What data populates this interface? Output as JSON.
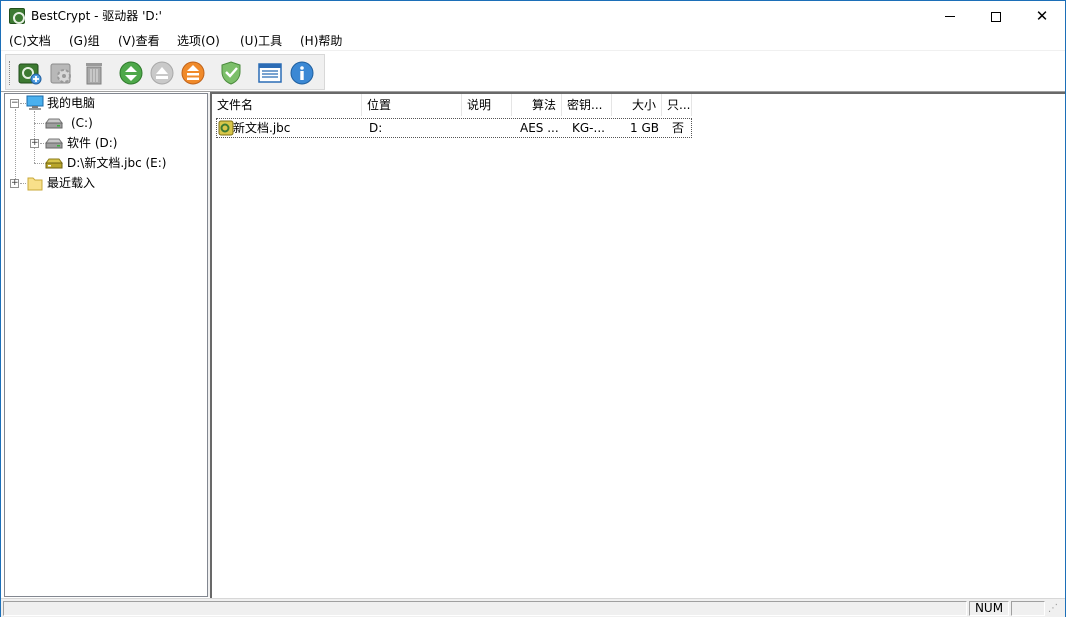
{
  "window": {
    "title": "BestCrypt - 驱动器 'D:'"
  },
  "menu": {
    "items": [
      "(C)文档",
      "(G)组",
      "(V)查看",
      "选项(O)",
      "(U)工具",
      "(H)帮助"
    ]
  },
  "toolbar": {
    "buttons": [
      {
        "name": "new-container-icon",
        "color": "#3d7a32"
      },
      {
        "name": "gear-icon",
        "color": "#a8a8a8"
      },
      {
        "name": "trash-icon",
        "color": "#8a8a8a"
      },
      {
        "name": "mount-icon",
        "color": "#4ea84a"
      },
      {
        "name": "dismount-icon",
        "color": "#c0c0c0"
      },
      {
        "name": "dismount-all-icon",
        "color": "#f08a2a"
      },
      {
        "name": "shield-icon",
        "color": "#6aaa5a"
      },
      {
        "name": "properties-icon",
        "color": "#2b6cb5"
      },
      {
        "name": "info-icon",
        "color": "#3b88d4"
      }
    ]
  },
  "tree": {
    "root_label": "我的电脑",
    "items": [
      {
        "label": "(C:)",
        "icon": "drive-icon"
      },
      {
        "label": "软件 (D:)",
        "icon": "drive-icon"
      },
      {
        "label": "D:\\新文档.jbc (E:)",
        "icon": "encrypted-drive-icon"
      }
    ],
    "recent_label": "最近载入"
  },
  "list": {
    "columns": [
      "文件名",
      "位置",
      "说明",
      "算法",
      "密钥...",
      "大小",
      "只..."
    ],
    "rows": [
      {
        "name": "新文档.jbc",
        "location": "D:",
        "description": "",
        "algorithm": "AES ...",
        "key": "KG-...",
        "size": "1 GB",
        "readonly": "否"
      }
    ]
  },
  "status": {
    "num": "NUM"
  }
}
